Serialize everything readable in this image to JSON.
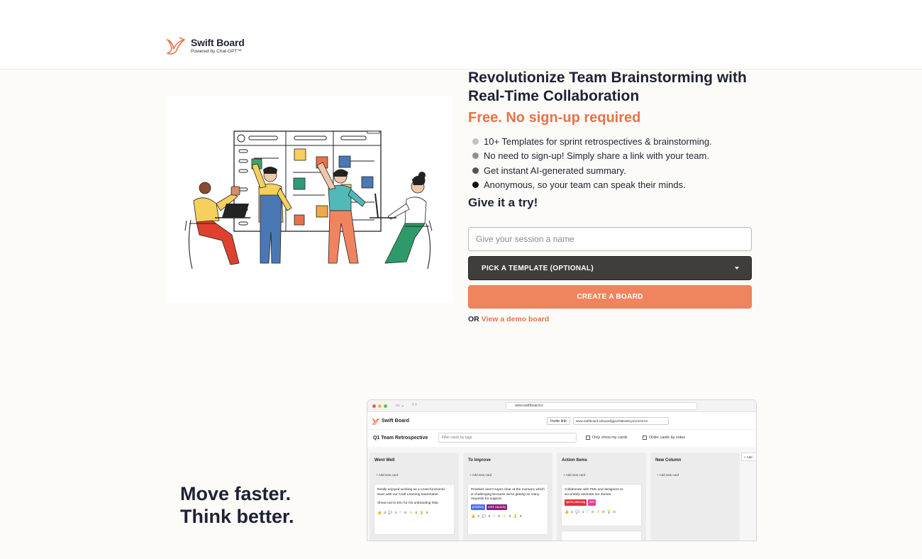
{
  "header": {
    "brand_name": "Swift Board",
    "brand_subtitle": "Powered by Chat-GPT™"
  },
  "hero": {
    "title": "Revolutionize Team Brainstorming with Real-Time Collaboration",
    "tagline": "Free. No sign-up required",
    "features": [
      {
        "text": "10+ Templates for sprint retrospectives & brainstorming.",
        "dot_color": "#c2c2c2"
      },
      {
        "text": "No need to sign-up! Simply share a link with your team.",
        "dot_color": "#8f8f8f"
      },
      {
        "text": "Get instant AI-generated summary.",
        "dot_color": "#555555"
      },
      {
        "text": "Anonymous, so your team can speak their minds.",
        "dot_color": "#111111"
      }
    ],
    "try_heading": "Give it a try!",
    "session_placeholder": "Give your session a name",
    "template_label": "PICK A TEMPLATE (OPTIONAL)",
    "create_label": "CREATE A BOARD",
    "or_text": "OR",
    "demo_link": "View a demo board"
  },
  "section2": {
    "line1": "Move faster.",
    "line2": "Think better."
  },
  "preview": {
    "url": "www.swiftboard.io",
    "app_name": "Swift Board",
    "invite_label": "Invite link",
    "invite_url": "www.swiftboard.io/board/gljsvOMtiaWcj4A2oX4Am",
    "board_title": "Q1 Team Retrospective",
    "filter_placeholder": "Filter cards by tags",
    "only_mine": "Only show my cards",
    "order_votes": "Order cards by votes",
    "add_column": "+ Add",
    "columns": [
      {
        "title": "Went Well",
        "add": "+ Add new card",
        "card": "Really enjoyed working as a cross-functional team with our Craft Learning teammates.",
        "card_extra": "Shout-out to Eric for his onboarding help",
        "tags": [],
        "reactions": "👍 3  💬 1  ♡ 0  ✨ 0  💡 0"
      },
      {
        "title": "To Improve",
        "add": "+ Add new card",
        "card": "Priorities aren't super clear at the moment, which is challenging because we're getting so many requests for support.",
        "card_extra": "",
        "tags": [
          {
            "label": "priorities",
            "color": "#4a6cf7"
          },
          {
            "label": "work capacity",
            "color": "#8a1c7c"
          }
        ],
        "reactions": "👍 2  💬 0  ♡ 0  ✨ 0  💡 0"
      },
      {
        "title": "Action Items",
        "add": "+ Add new card",
        "card": "Collaborate with PMs and designers to accurately estimate our stories",
        "card_extra": "",
        "tags": [
          {
            "label": "sprint planning",
            "color": "#e0323c"
          },
          {
            "label": "Eric",
            "color": "#e83e9a"
          }
        ],
        "reactions": "👍 2  💬 1  ♡ 0  ✨ 0  💡 0"
      },
      {
        "title": "New Column",
        "add": "+ Add new card",
        "card": "",
        "card_extra": "",
        "tags": [],
        "reactions": ""
      }
    ]
  },
  "colors": {
    "accent": "#e8724a",
    "navy": "#1e2235",
    "button_dark": "#3f3e3b",
    "button_orange": "#f0845f"
  }
}
